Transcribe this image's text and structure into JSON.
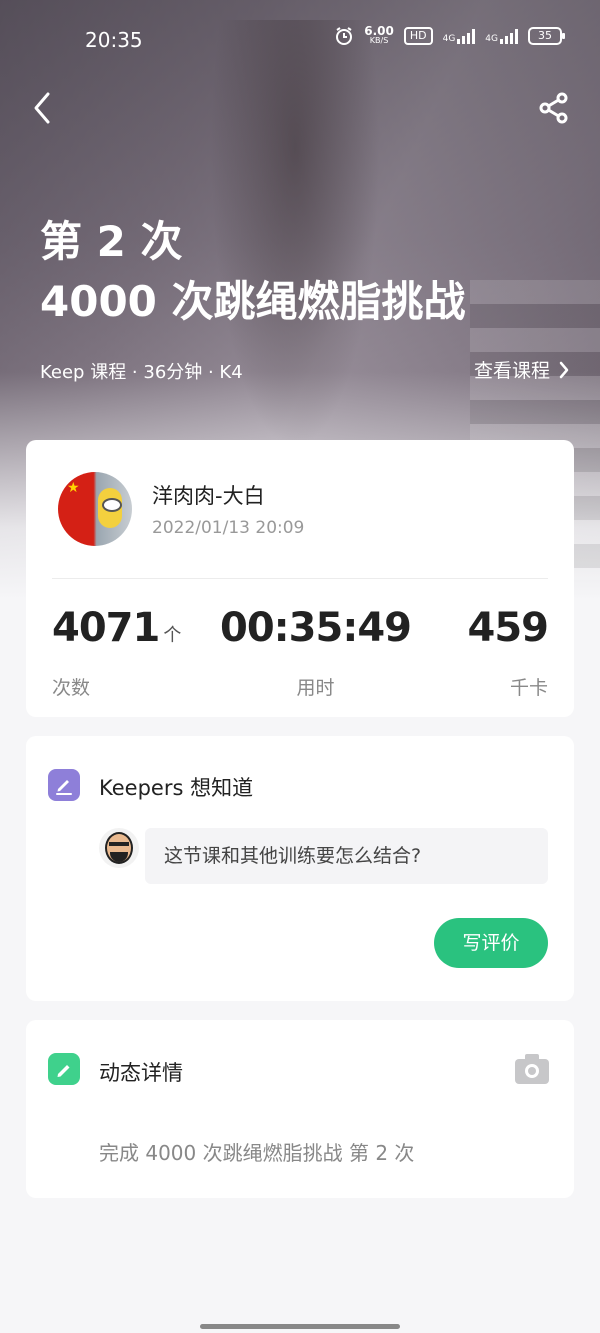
{
  "status_bar": {
    "time": "20:35",
    "net_speed": "6.00",
    "net_speed_unit": "KB/S",
    "hd_label": "HD",
    "signal1_label": "4G",
    "signal2_label": "4G",
    "battery": "35"
  },
  "header": {
    "back_icon": "chevron-left-icon",
    "share_icon": "share-icon",
    "title_line1": "第 2 次",
    "title_line2": "4000 次跳绳燃脂挑战",
    "meta": "Keep 课程 · 36分钟 · K4",
    "view_course_label": "查看课程"
  },
  "workout": {
    "user_name": "洋肉肉-大白",
    "date": "2022/01/13 20:09",
    "stats": [
      {
        "value": "4071",
        "unit": "个",
        "label": "次数"
      },
      {
        "value": "00:35:49",
        "unit": "",
        "label": "用时"
      },
      {
        "value": "459",
        "unit": "",
        "label": "千卡"
      }
    ]
  },
  "keepers": {
    "icon": "pencil-icon",
    "title": "Keepers 想知道",
    "question": "这节课和其他训练要怎么结合?",
    "button_label": "写评价",
    "button_color": "#2ac27f"
  },
  "feed": {
    "icon": "edit-icon",
    "title": "动态详情",
    "camera_icon": "camera-icon",
    "text": "完成 4000 次跳绳燃脂挑战 第 2 次"
  },
  "colors": {
    "accent_green": "#2ac27f",
    "keepers_purple": "#8e7fd9",
    "feed_green": "#3fd18c"
  }
}
